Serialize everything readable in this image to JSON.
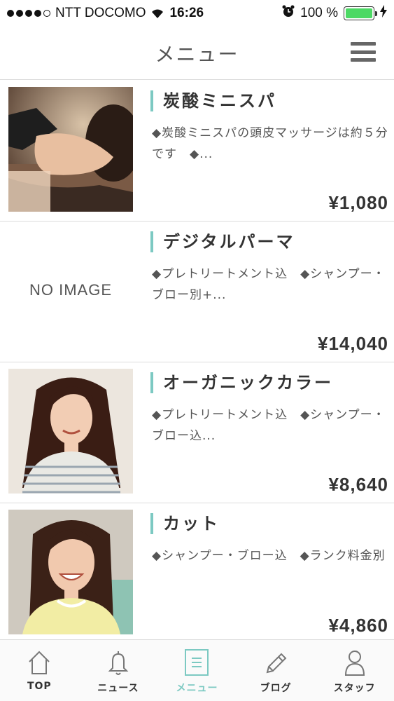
{
  "status_bar": {
    "carrier": "NTT DOCOMO",
    "time": "16:26",
    "battery": "100 %",
    "battery_level": 1.0
  },
  "nav": {
    "title": "メニュー",
    "menu_icon": "hamburger-menu-icon"
  },
  "menu_items": [
    {
      "title": "炭酸ミニスパ",
      "description": "◆炭酸ミニスパの頭皮マッサージは約５分です　◆...",
      "price": "¥1,080",
      "image": "photo-head-spa"
    },
    {
      "title": "デジタルパーマ",
      "description": "◆プレトリートメント込　◆シャンプー・ブロー別+...",
      "price": "¥14,040",
      "image_placeholder": "NO IMAGE"
    },
    {
      "title": "オーガニックカラー",
      "description": "◆プレトリートメント込　◆シャンプー・ブロー込...",
      "price": "¥8,640",
      "image": "photo-woman-smiling"
    },
    {
      "title": "カット",
      "description": "◆シャンプー・ブロー込　◆ランク料金別",
      "price": "¥4,860",
      "image": "photo-woman-laughing"
    }
  ],
  "tabs": [
    {
      "label": "TOP",
      "icon": "home-icon",
      "active": false
    },
    {
      "label": "ニュース",
      "icon": "bell-icon",
      "active": false
    },
    {
      "label": "メニュー",
      "icon": "menu-list-icon",
      "active": true
    },
    {
      "label": "ブログ",
      "icon": "pencil-icon",
      "active": false
    },
    {
      "label": "スタッフ",
      "icon": "person-icon",
      "active": false
    }
  ],
  "colors": {
    "accent": "#7cc9c2",
    "battery": "#4cd964",
    "divider": "#dcdcdc",
    "text": "#333333"
  }
}
